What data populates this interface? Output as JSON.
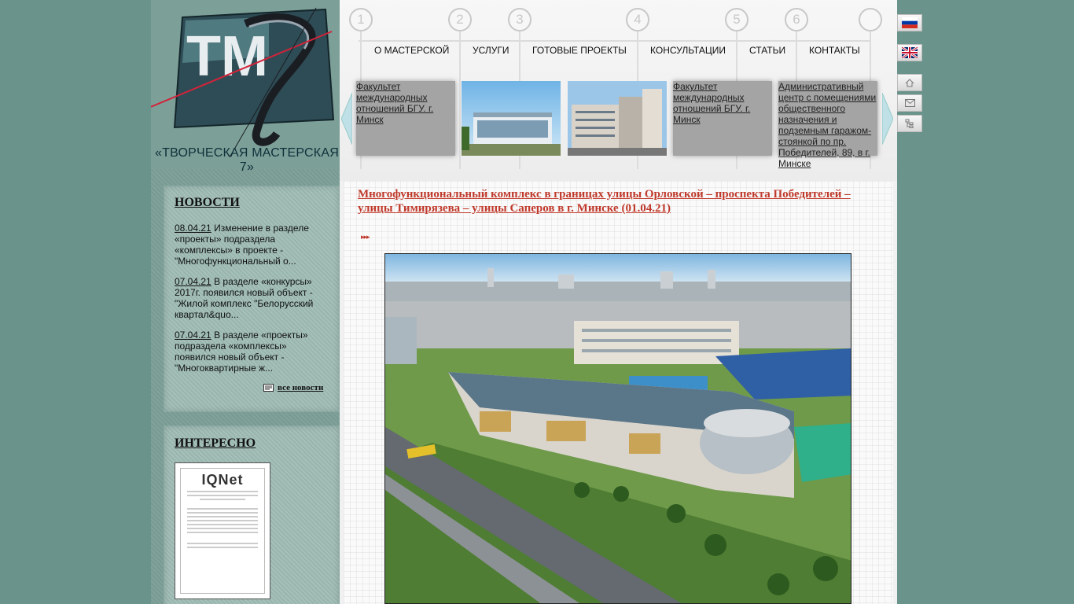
{
  "brand": {
    "caption": "«ТВОРЧЕСКАЯ МАСТЕРСКАЯ 7»",
    "logo_text": "ТМ"
  },
  "menu": {
    "numbers": [
      "1",
      "2",
      "3",
      "4",
      "5",
      "6",
      ""
    ],
    "items": [
      "О МАСТЕРСКОЙ",
      "УСЛУГИ",
      "ГОТОВЫЕ ПРОЕКТЫ",
      "КОНСУЛЬТАЦИИ",
      "СТАТЬИ",
      "КОНТАКТЫ"
    ]
  },
  "slider": {
    "items": [
      {
        "alt": "Факультет международных отношений БГУ. г. Минск"
      },
      {
        "alt": ""
      },
      {
        "alt": ""
      },
      {
        "alt": "Факультет международных отношений БГУ. г. Минск"
      },
      {
        "alt": "Административный центр с помещениями общественного назначения и подземным гаражом-стоянкой по пр. Победителей, 89, в г. Минске"
      }
    ]
  },
  "news": {
    "title": "НОВОСТИ",
    "items": [
      {
        "date": "08.04.21",
        "text": "Изменение в разделе «проекты» подраздела «комплексы» в проекте - \"Многофункциональный о..."
      },
      {
        "date": "07.04.21",
        "text": "В разделе «конкурсы» 2017г. появился новый объект - \"Жилой комплекс \"Белорусский квартал&quo..."
      },
      {
        "date": "07.04.21",
        "text": "В разделе «проекты» подраздела «комплексы» появился новый объект - \"Многоквартирные ж..."
      }
    ],
    "all_label": "все новости"
  },
  "interesting": {
    "title": "ИНТЕРЕСНО",
    "cert_brand": "IQNet"
  },
  "article": {
    "title": "Многофункциональный комплекс в границах улицы Орловской – проспекта Победителей – улицы Тимирязева – улицы Саперов в г. Минске (01.04.21)",
    "bullet": "▸▸▸"
  },
  "colors": {
    "accent": "#c0392b",
    "background": "#6a938b"
  }
}
